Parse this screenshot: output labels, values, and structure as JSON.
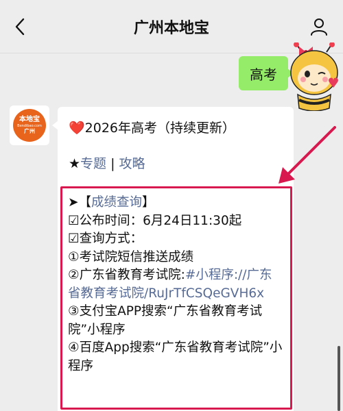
{
  "header": {
    "title": "广州本地宝"
  },
  "outgoing": {
    "text": "高考"
  },
  "incoming": {
    "avatar": {
      "logo_main": "本地宝",
      "logo_sub": "Bendibao.com",
      "logo_city": "广州"
    },
    "heart": "❤️",
    "title": "2026年高考（持续更新）",
    "star": "★",
    "link_topic": "专题",
    "separator": " | ",
    "link_guide": "攻略",
    "section_arrow": "➤【",
    "section_link": "成绩查询",
    "section_close": "】",
    "publish_label": "☑公布时间：",
    "publish_time": "6月24日11:30起",
    "method_label": "☑查询方式：",
    "method1": "①考试院短信推送成绩",
    "method2_prefix": "②广东省教育考试院:",
    "method2_link": "#小程序://广东省教育考试院/RuJrTfCSQeGVH6x",
    "method3": "③支付宝APP搜索“广东省教育考试院”小程序",
    "method4": "④百度App搜索“广东省教育考试院”小程序"
  },
  "colors": {
    "bubble_out": "#95ec69",
    "link": "#576b95",
    "highlight_border": "#d7194f",
    "heart": "#e02020",
    "logo_bg": "#e8641c"
  }
}
